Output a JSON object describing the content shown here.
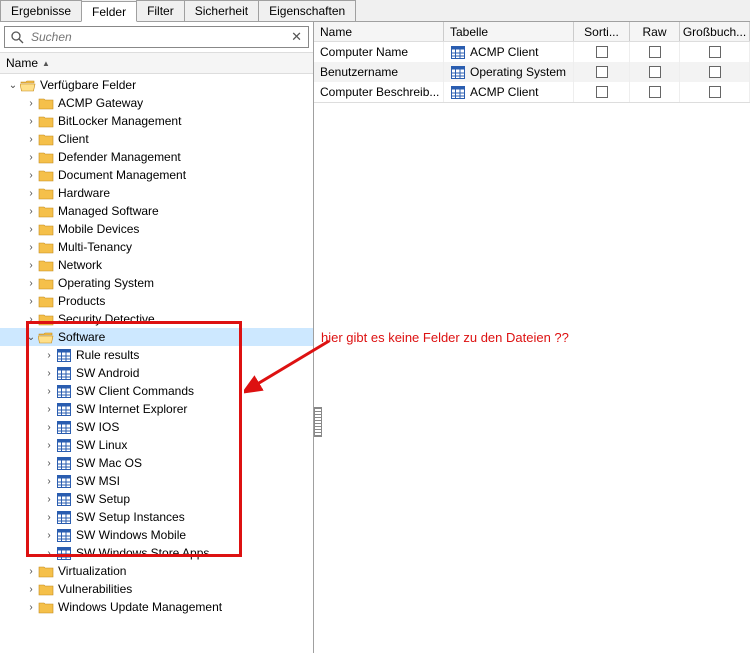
{
  "tabs": [
    "Ergebnisse",
    "Felder",
    "Filter",
    "Sicherheit",
    "Eigenschaften"
  ],
  "activeTab": 1,
  "search": {
    "placeholder": "Suchen"
  },
  "leftHeader": "Name",
  "tree": [
    {
      "level": 0,
      "exp": "v",
      "type": "folder-open",
      "label": "Verfügbare Felder"
    },
    {
      "level": 1,
      "exp": ">",
      "type": "folder",
      "label": "ACMP Gateway"
    },
    {
      "level": 1,
      "exp": ">",
      "type": "folder",
      "label": "BitLocker Management"
    },
    {
      "level": 1,
      "exp": ">",
      "type": "folder",
      "label": "Client"
    },
    {
      "level": 1,
      "exp": ">",
      "type": "folder",
      "label": "Defender Management"
    },
    {
      "level": 1,
      "exp": ">",
      "type": "folder",
      "label": "Document Management"
    },
    {
      "level": 1,
      "exp": ">",
      "type": "folder",
      "label": "Hardware"
    },
    {
      "level": 1,
      "exp": ">",
      "type": "folder",
      "label": "Managed Software"
    },
    {
      "level": 1,
      "exp": ">",
      "type": "folder",
      "label": "Mobile Devices"
    },
    {
      "level": 1,
      "exp": ">",
      "type": "folder",
      "label": "Multi-Tenancy"
    },
    {
      "level": 1,
      "exp": ">",
      "type": "folder",
      "label": "Network"
    },
    {
      "level": 1,
      "exp": ">",
      "type": "folder",
      "label": "Operating System"
    },
    {
      "level": 1,
      "exp": ">",
      "type": "folder",
      "label": "Products"
    },
    {
      "level": 1,
      "exp": ">",
      "type": "folder",
      "label": "Security Detective"
    },
    {
      "level": 1,
      "exp": "v",
      "type": "folder-open",
      "label": "Software",
      "selected": true
    },
    {
      "level": 2,
      "exp": ">",
      "type": "table",
      "label": "Rule results"
    },
    {
      "level": 2,
      "exp": ">",
      "type": "table",
      "label": "SW Android"
    },
    {
      "level": 2,
      "exp": ">",
      "type": "table",
      "label": "SW Client Commands"
    },
    {
      "level": 2,
      "exp": ">",
      "type": "table",
      "label": "SW Internet Explorer"
    },
    {
      "level": 2,
      "exp": ">",
      "type": "table",
      "label": "SW IOS"
    },
    {
      "level": 2,
      "exp": ">",
      "type": "table",
      "label": "SW Linux"
    },
    {
      "level": 2,
      "exp": ">",
      "type": "table",
      "label": "SW Mac OS"
    },
    {
      "level": 2,
      "exp": ">",
      "type": "table",
      "label": "SW MSI"
    },
    {
      "level": 2,
      "exp": ">",
      "type": "table",
      "label": "SW Setup"
    },
    {
      "level": 2,
      "exp": ">",
      "type": "table",
      "label": "SW Setup Instances"
    },
    {
      "level": 2,
      "exp": ">",
      "type": "table",
      "label": "SW Windows Mobile"
    },
    {
      "level": 2,
      "exp": ">",
      "type": "table",
      "label": "SW Windows Store Apps"
    },
    {
      "level": 1,
      "exp": ">",
      "type": "folder",
      "label": "Virtualization"
    },
    {
      "level": 1,
      "exp": ">",
      "type": "folder",
      "label": "Vulnerabilities"
    },
    {
      "level": 1,
      "exp": ">",
      "type": "folder",
      "label": "Windows Update Management"
    }
  ],
  "rightHeaders": {
    "name": "Name",
    "table": "Tabelle",
    "sort": "Sorti...",
    "raw": "Raw",
    "gb": "Großbuch..."
  },
  "rightRows": [
    {
      "name": "Computer Name",
      "table": "ACMP Client"
    },
    {
      "name": "Benutzername",
      "table": "Operating System"
    },
    {
      "name": "Computer Beschreib...",
      "table": "ACMP Client"
    }
  ],
  "annotation": "hier gibt es keine Felder zu den Dateien ??"
}
